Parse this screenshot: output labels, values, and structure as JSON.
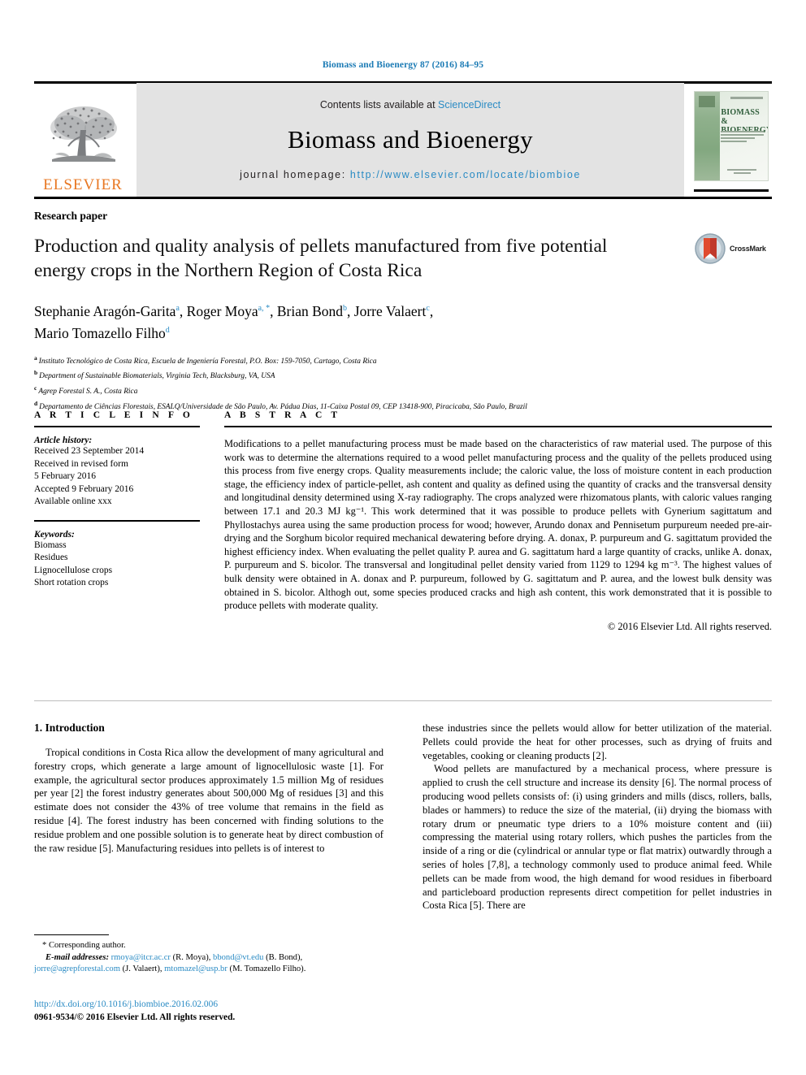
{
  "running_head": "Biomass and Bioenergy 87 (2016) 84–95",
  "masthead": {
    "publisher_name": "ELSEVIER",
    "contents_prefix": "Contents lists available at ",
    "contents_link": "ScienceDirect",
    "journal_title": "Biomass and Bioenergy",
    "homepage_prefix": "journal homepage: ",
    "homepage_url": "http://www.elsevier.com/locate/biombioe",
    "cover_title": "BIOMASS & BIOENERGY"
  },
  "article": {
    "type": "Research paper",
    "title": "Production and quality analysis of pellets manufactured from five potential energy crops in the Northern Region of Costa Rica",
    "crossmark_label": "CrossMark",
    "authors": [
      {
        "name": "Stephanie Aragón-Garita",
        "marks": "a"
      },
      {
        "name": "Roger Moya",
        "marks": "a, *"
      },
      {
        "name": "Brian Bond",
        "marks": "b"
      },
      {
        "name": "Jorre Valaert",
        "marks": "c"
      },
      {
        "name": "Mario Tomazello Filho",
        "marks": "d"
      }
    ],
    "affiliations": [
      {
        "mark": "a",
        "text": "Instituto Tecnológico de Costa Rica, Escuela de Ingeniería Forestal, P.O. Box: 159-7050, Cartago, Costa Rica"
      },
      {
        "mark": "b",
        "text": "Department of Sustainable Biomaterials, Virginia Tech, Blacksburg, VA, USA"
      },
      {
        "mark": "c",
        "text": "Agrep Forestal S. A., Costa Rica"
      },
      {
        "mark": "d",
        "text": "Departamento de Ciências Florestais, ESALQ/Universidade de São Paulo, Av. Pádua Dias, 11-Caixa Postal 09, CEP 13418-900, Piracicaba, São Paulo, Brazil"
      }
    ]
  },
  "article_info": {
    "heading": "A R T I C L E   I N F O",
    "history_label": "Article history:",
    "history": [
      "Received 23 September 2014",
      "Received in revised form",
      "5 February 2016",
      "Accepted 9 February 2016",
      "Available online xxx"
    ],
    "keywords_label": "Keywords:",
    "keywords": [
      "Biomass",
      "Residues",
      "Lignocellulose crops",
      "Short rotation crops"
    ]
  },
  "abstract": {
    "heading": "A B S T R A C T",
    "text": "Modifications to a pellet manufacturing process must be made based on the characteristics of raw material used. The purpose of this work was to determine the alternations required to a wood pellet manufacturing process and the quality of the pellets produced using this process from five energy crops. Quality measurements include; the caloric value, the loss of moisture content in each production stage, the efficiency index of particle-pellet, ash content and quality as defined using the quantity of cracks and the transversal density and longitudinal density determined using X-ray radiography. The crops analyzed were rhizomatous plants, with caloric values ranging between 17.1 and 20.3 MJ kg⁻¹. This work determined that it was possible to produce pellets with Gynerium sagittatum and Phyllostachys aurea using the same production process for wood; however, Arundo donax and Pennisetum purpureum needed pre-air-drying and the Sorghum bicolor required mechanical dewatering before drying. A. donax, P. purpureum and G. sagittatum provided the highest efficiency index. When evaluating the pellet quality P. aurea and G. sagittatum hard a large quantity of cracks, unlike A. donax, P. purpureum and S. bicolor. The transversal and longitudinal pellet density varied from 1129 to 1294 kg m⁻³. The highest values of bulk density were obtained in A. donax and P. purpureum, followed by G. sagittatum and P. aurea, and the lowest bulk density was obtained in S. bicolor. Althogh out, some species produced cracks and high ash content, this work demonstrated that it is possible to produce pellets with moderate quality.",
    "copyright": "© 2016 Elsevier Ltd. All rights reserved."
  },
  "body": {
    "section_number_title": "1.  Introduction",
    "left_paragraphs": [
      "Tropical conditions in Costa Rica allow the development of many agricultural and forestry crops, which generate a large amount of lignocellulosic waste [1]. For example, the agricultural sector produces approximately 1.5 million Mg of residues per year [2] the forest industry generates about 500,000 Mg of residues [3] and this estimate does not consider the 43% of tree volume that remains in the field as residue [4]. The forest industry has been concerned with finding solutions to the residue problem and one possible solution is to generate heat by direct combustion of the raw residue [5]. Manufacturing residues into pellets is of interest to"
    ],
    "right_paragraphs": [
      "these industries since the pellets would allow for better utilization of the material. Pellets could provide the heat for other processes, such as drying of fruits and vegetables, cooking or cleaning products [2].",
      "Wood pellets are manufactured by a mechanical process, where pressure is applied to crush the cell structure and increase its density [6]. The normal process of producing wood pellets consists of: (i) using grinders and mills (discs, rollers, balls, blades or hammers) to reduce the size of the material, (ii) drying the biomass with rotary drum or pneumatic type driers to a 10% moisture content and (iii) compressing the material using rotary rollers, which pushes the particles from the inside of a ring or die (cylindrical or annular type or flat matrix) outwardly through a series of holes [7,8], a technology commonly used to produce animal feed. While pellets can be made from wood, the high demand for wood residues in fiberboard and particleboard production represents direct competition for pellet industries in Costa Rica [5]. There are"
    ]
  },
  "footnote": {
    "corresponding": "* Corresponding author.",
    "email_label": "E-mail addresses:",
    "emails": [
      {
        "address": "rmoya@itcr.ac.cr",
        "person": "(R. Moya)"
      },
      {
        "address": "bbond@vt.edu",
        "person": "(B. Bond)"
      },
      {
        "address": "jorre@agrepforestal.com",
        "person": "(J. Valaert)"
      },
      {
        "address": "mtomazel@usp.br",
        "person": "(M. Tomazello Filho)"
      }
    ]
  },
  "doi": {
    "url": "http://dx.doi.org/10.1016/j.biombioe.2016.02.006",
    "issn_line": "0961-9534/© 2016 Elsevier Ltd. All rights reserved."
  },
  "colors": {
    "link_blue": "#2a8bc4",
    "running_head_blue": "#1c7bb5",
    "elsevier_orange": "#E87722",
    "masthead_grey": "#e3e3e3"
  }
}
